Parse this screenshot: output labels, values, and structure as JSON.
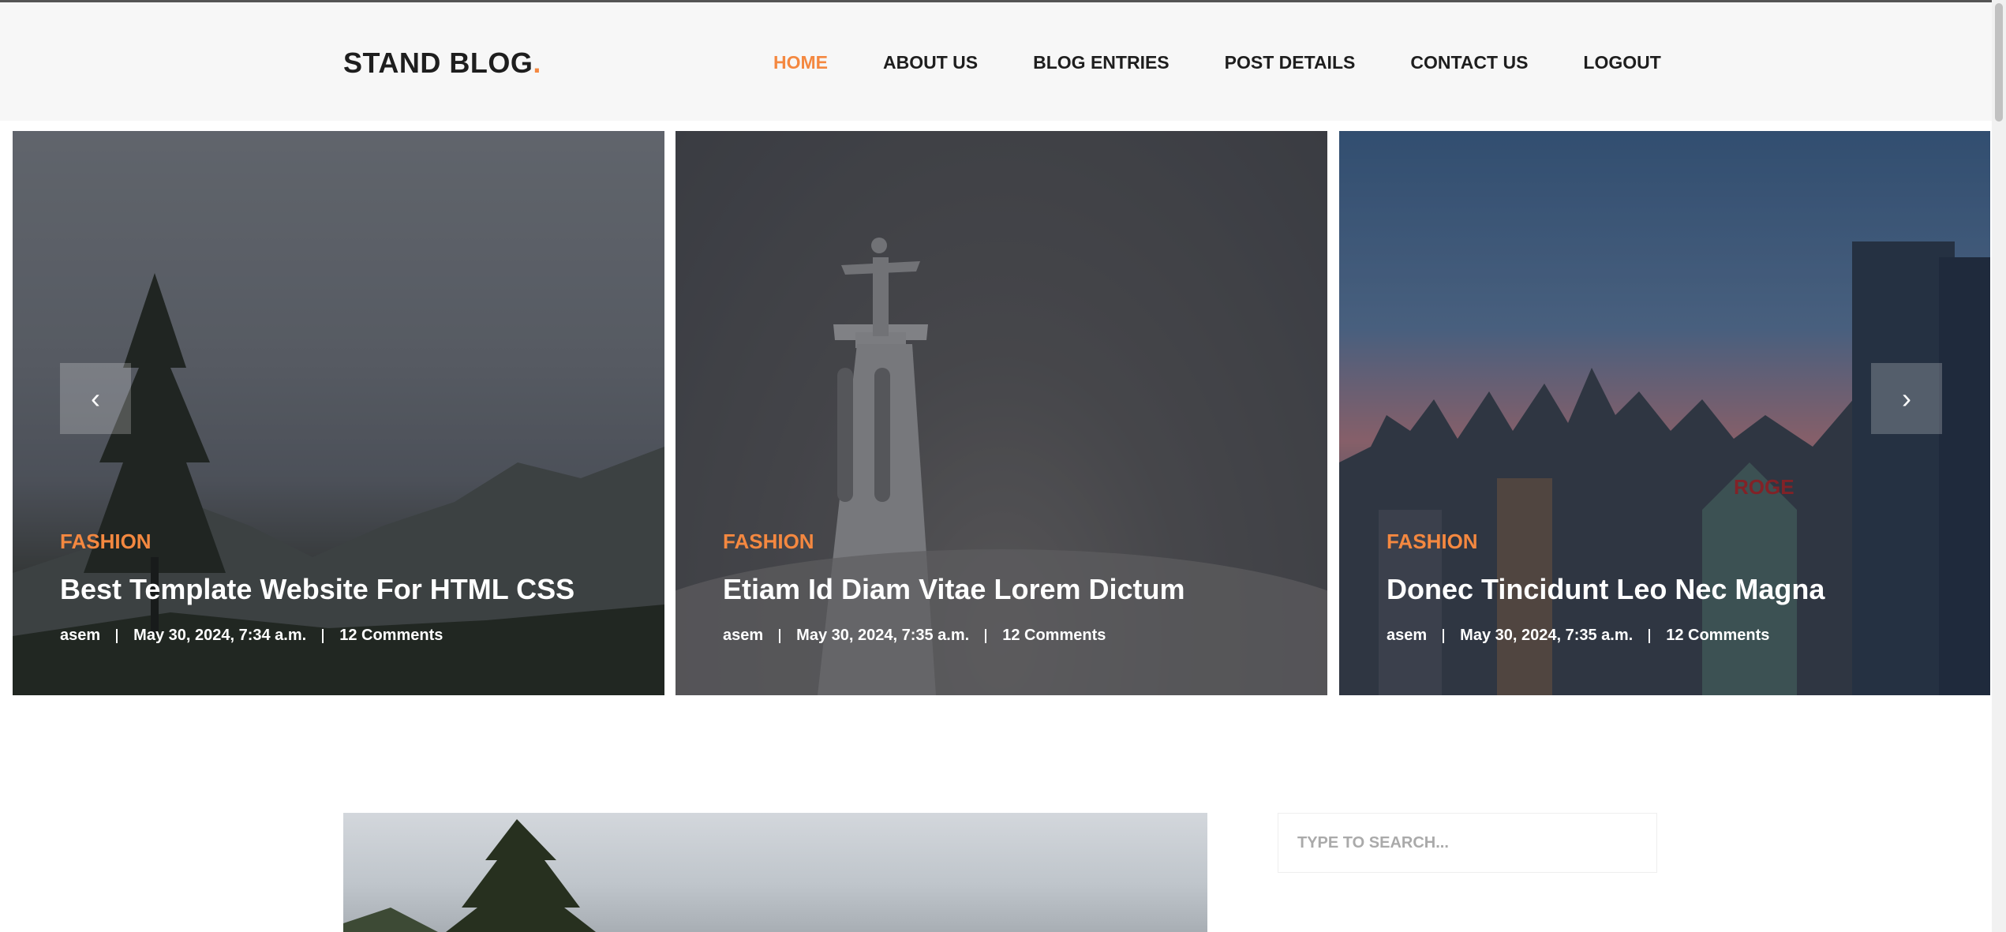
{
  "brand": {
    "name": "STAND BLOG",
    "dot": ".",
    "accent": "#f48840"
  },
  "nav": {
    "items": [
      {
        "label": "HOME",
        "active": true
      },
      {
        "label": "ABOUT US"
      },
      {
        "label": "BLOG ENTRIES"
      },
      {
        "label": "POST DETAILS"
      },
      {
        "label": "CONTACT US"
      },
      {
        "label": "LOGOUT"
      }
    ]
  },
  "slider": {
    "prev_icon": "‹",
    "next_icon": "›",
    "slides": [
      {
        "category": "FASHION",
        "title": "Best Template Website For HTML CSS",
        "author": "asem",
        "date": "May 30, 2024, 7:34 a.m.",
        "comments": "12 Comments"
      },
      {
        "category": "FASHION",
        "title": "Etiam Id Diam Vitae Lorem Dictum",
        "author": "asem",
        "date": "May 30, 2024, 7:35 a.m.",
        "comments": "12 Comments"
      },
      {
        "category": "FASHION",
        "title": "Donec Tincidunt Leo Nec Magna",
        "author": "asem",
        "date": "May 30, 2024, 7:35 a.m.",
        "comments": "12 Comments"
      }
    ]
  },
  "sidebar": {
    "search_placeholder": "TYPE TO SEARCH..."
  }
}
